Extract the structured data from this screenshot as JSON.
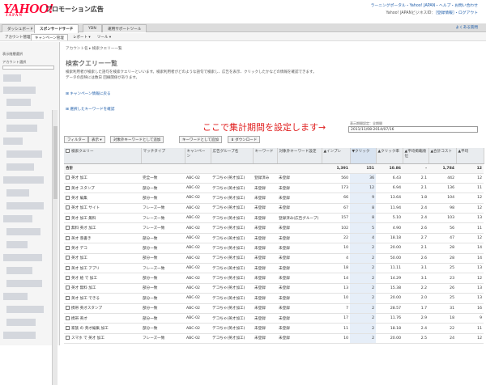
{
  "header": {
    "logo": "YAHOO!",
    "logo_sub": "JAPAN",
    "product": "プロモーション広告",
    "links": "ラーニングポータル・Yahoo! JAPAN・ヘルプ・お問い合わせ",
    "user_prefix": "Yahoo! JAPANビジネスID：",
    "user_links": "［登録情報］・ログアウト"
  },
  "global_nav": {
    "tabs": [
      "ダッシュボード",
      "スポンサードサーチ",
      "YDN",
      "運用サポートツール"
    ],
    "active": 1,
    "help": "よくある質問"
  },
  "sub_nav": {
    "tabs": [
      "アカウント管理",
      "キャンペーン管理",
      "レポート ▾",
      "ツール ▾"
    ],
    "active": 1
  },
  "sidebar": {
    "search_label": "表示階層選択",
    "account_label": "アカウント選択"
  },
  "main": {
    "breadcrumb": "アカウント名 ▸ 検索クエリー一覧",
    "title": "検索クエリー一覧",
    "desc1": "検索利用者が検索した語句を検索クエリーといいます。検索利用者がどのような語句で検索し、広告を表示、クリックしたかなどの情報を確認できます。",
    "desc2": "データの反映には数日 回線関係があります。",
    "toggle_campaign": "⊞ キャンペーン情報に戻る",
    "toggle_keywords": "⊞ 選択したキーワードを確認",
    "annotation": "ここで集計期間を設定します→",
    "period_label": "表示期間設定：全期間",
    "period_value": "2011/11/08-2014/07/16"
  },
  "toolbar": {
    "buttons": [
      "フィルター",
      "表示 ▾",
      "対象外キーワードとして追加",
      "キーワードとして追加",
      "⬇ ダウンロード"
    ]
  },
  "table": {
    "headers": [
      "検索クエリー",
      "マッチタイプ",
      "キャンペーン",
      "広告グループ名",
      "キーワード",
      "対象外キーワード設定",
      "▲インプレ",
      "▼クリック",
      "▲クリック率",
      "▲平均掲載順位",
      "▲合計コスト",
      "▲平均"
    ],
    "total": {
      "label": "合計",
      "values": [
        "1,391",
        "151",
        "10.86",
        "-",
        "1,784",
        "12"
      ]
    },
    "rows": [
      [
        "英才 加工",
        "完全一致",
        "ABC-02",
        "デコちゃ(英才加工)",
        "登録済み",
        "未登録",
        "560",
        "36",
        "6.43",
        "2.1",
        "442",
        "12"
      ],
      [
        "英才 スタンプ",
        "部分一致",
        "ABC-02",
        "デコちゃ(英才加工)",
        "未登録",
        "未登録",
        "173",
        "12",
        "6.94",
        "2.1",
        "136",
        "11"
      ],
      [
        "英才 編集",
        "部分一致",
        "ABC-02",
        "デコちゃ(英才加工)",
        "未登録",
        "未登録",
        "66",
        "9",
        "13.64",
        "1.8",
        "104",
        "12"
      ],
      [
        "英才 加工 サイト",
        "フレーズ一致",
        "ABC-02",
        "デコちゃ(英才加工)",
        "未登録",
        "未登録",
        "67",
        "8",
        "11.94",
        "2.4",
        "98",
        "12"
      ],
      [
        "英才 加工 無料",
        "フレーズ一致",
        "ABC-02",
        "デコちゃ(英才加工)",
        "未登録",
        "登録済み(広告グループ)",
        "157",
        "8",
        "5.10",
        "2.4",
        "103",
        "13"
      ],
      [
        "無料 英才 加工",
        "フレーズ一致",
        "ABC-02",
        "デコちゃ(英才加工)",
        "未登録",
        "未登録",
        "102",
        "5",
        "4.90",
        "2.6",
        "56",
        "11"
      ],
      [
        "英才 落書き",
        "部分一致",
        "ABC-02",
        "デコちゃ(英才加工)",
        "未登録",
        "未登録",
        "22",
        "4",
        "18.18",
        "2.7",
        "47",
        "12"
      ],
      [
        "英才 デコ",
        "部分一致",
        "ABC-02",
        "デコちゃ(英才加工)",
        "未登録",
        "未登録",
        "10",
        "2",
        "20.00",
        "2.1",
        "28",
        "14"
      ],
      [
        "英才 加工",
        "部分一致",
        "ABC-02",
        "デコちゃ(英才加工)",
        "未登録",
        "未登録",
        "4",
        "2",
        "50.00",
        "2.6",
        "28",
        "14"
      ],
      [
        "英才 加工 アプリ",
        "フレーズ一致",
        "ABC-02",
        "デコちゃ(英才加工)",
        "未登録",
        "未登録",
        "18",
        "2",
        "11.11",
        "3.1",
        "25",
        "13"
      ],
      [
        "英才 絵 で 加工",
        "部分一致",
        "ABC-02",
        "デコちゃ(英才加工)",
        "未登録",
        "未登録",
        "14",
        "2",
        "14.29",
        "3.1",
        "23",
        "12"
      ],
      [
        "英才 無料 加工",
        "部分一致",
        "ABC-02",
        "デコちゃ(英才加工)",
        "未登録",
        "未登録",
        "13",
        "2",
        "15.38",
        "2.2",
        "26",
        "13"
      ],
      [
        "英才 加工 できる",
        "部分一致",
        "ABC-02",
        "デコちゃ(英才加工)",
        "未登録",
        "未登録",
        "10",
        "2",
        "20.00",
        "2.0",
        "25",
        "13"
      ],
      [
        "携帯 英才スタンプ",
        "部分一致",
        "ABC-02",
        "デコちゃ(英才加工)",
        "未登録",
        "未登録",
        "7",
        "2",
        "28.57",
        "1.7",
        "31",
        "16"
      ],
      [
        "携帯 英才",
        "部分一致",
        "ABC-02",
        "デコちゃ(英才加工)",
        "未登録",
        "未登録",
        "17",
        "2",
        "11.76",
        "2.9",
        "18",
        "9"
      ],
      [
        "家族 の 英才編集 加工",
        "部分一致",
        "ABC-02",
        "デコちゃ(英才加工)",
        "未登録",
        "未登録",
        "11",
        "2",
        "18.18",
        "2.4",
        "22",
        "11"
      ],
      [
        "スマホ で 英才 加工",
        "フレーズ一致",
        "ABC-02",
        "デコちゃ(英才加工)",
        "未登録",
        "未登録",
        "10",
        "2",
        "20.00",
        "2.5",
        "24",
        "12"
      ]
    ]
  }
}
